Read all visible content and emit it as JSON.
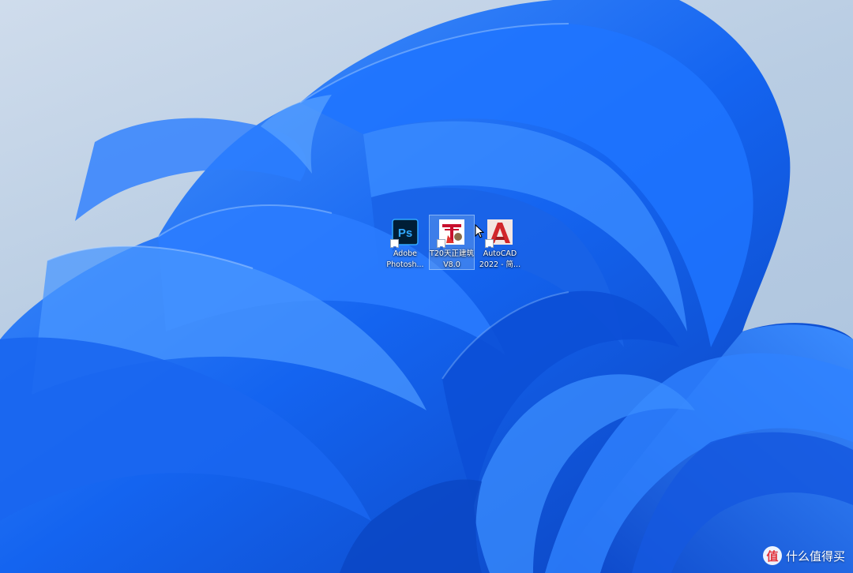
{
  "desktop": {
    "icons": [
      {
        "name": "photoshop",
        "label_line1": "Adobe",
        "label_line2": "Photosh...",
        "glyph": "Ps",
        "icon": "photoshop-app-icon",
        "selected": false
      },
      {
        "name": "t20-tianzheng",
        "label_line1": "T20天正建筑",
        "label_line2": "V8.0",
        "glyph": "T",
        "icon": "tianzheng-app-icon",
        "selected": true
      },
      {
        "name": "autocad",
        "label_line1": "AutoCAD",
        "label_line2": "2022 - 简...",
        "glyph": "A",
        "icon": "autocad-app-icon",
        "selected": false
      }
    ]
  },
  "watermark": {
    "badge": "值",
    "text": "什么值得买"
  },
  "colors": {
    "wallpaper_bg": "#b9cde3",
    "bloom_blue": "#0a5ee8",
    "photoshop_bg": "#001e36",
    "photoshop_fg": "#31a8ff",
    "autocad_red": "#d1262b",
    "selection": "#78aaeb"
  }
}
